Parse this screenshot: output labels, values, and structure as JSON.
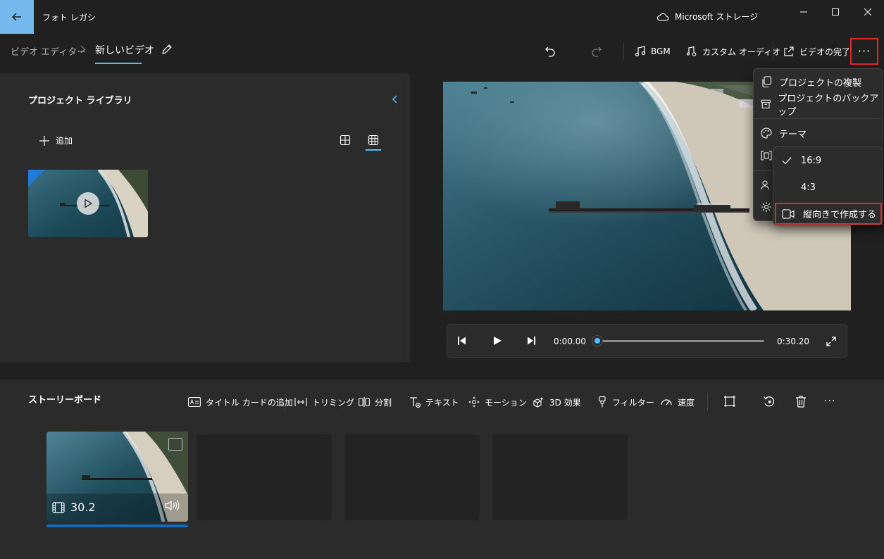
{
  "window": {
    "app_title": "フォト レガシ",
    "storage_label": "Microsoft ストレージ",
    "icons": [
      "back-arrow-icon",
      "cloud-icon",
      "minimize-icon",
      "maximize-icon",
      "close-icon"
    ]
  },
  "nav": {
    "breadcrumb_root": "ビデオ エディター",
    "breadcrumb_current": "新しいビデオ",
    "bgm_label": "BGM",
    "custom_audio_label": "カスタム オーディオ",
    "finish_video_label": "ビデオの完了",
    "more_label": "···"
  },
  "library": {
    "title": "プロジェクト ライブラリ",
    "add_label": "追加"
  },
  "player": {
    "current_time": "0:00.00",
    "total_time": "0:30.20",
    "progress": 0
  },
  "storyboard": {
    "title": "ストーリーボード",
    "tools": {
      "title_card": "タイトル カードの追加",
      "trim": "トリミング",
      "split": "分割",
      "text": "テキスト",
      "motion": "モーション",
      "effects_3d": "3D 効果",
      "filters": "フィルター",
      "speed": "速度"
    },
    "more_label": "···",
    "clips": [
      {
        "duration": "30.2"
      }
    ]
  },
  "menu": {
    "duplicate_project": "プロジェクトの複製",
    "backup_project": "プロジェクトのバックアップ",
    "theme": "テーマ",
    "aspect_options": [
      "16:9",
      "4:3"
    ],
    "selected_aspect": "16:9",
    "make_portrait": "縦向きで作成する"
  },
  "colors": {
    "accent": "#4cc2ff",
    "back_button": "#76b9ed",
    "highlight_box": "#e3262b",
    "panel": "#2b2b2b",
    "background": "#202020"
  }
}
